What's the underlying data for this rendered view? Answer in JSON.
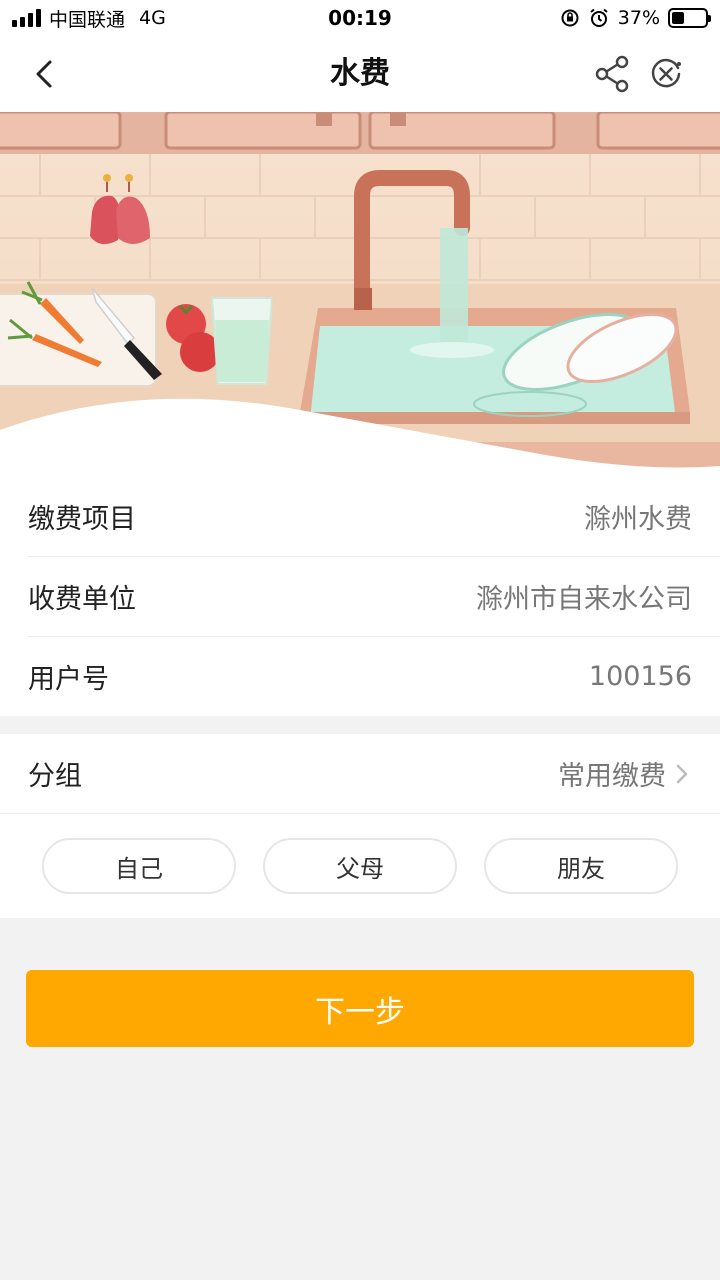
{
  "status_bar": {
    "carrier": "中国联通",
    "network": "4G",
    "time": "00:19",
    "battery_percent": "37%",
    "battery_level": 0.37
  },
  "nav": {
    "title": "水费",
    "back_icon": "chevron-left-icon",
    "share_icon": "share-icon",
    "close_icon": "close-circle-icon"
  },
  "banner": {
    "illustration": "kitchen-sink-water-illustration"
  },
  "info": {
    "rows": [
      {
        "label": "缴费项目",
        "value": "滁州水费"
      },
      {
        "label": "收费单位",
        "value": "滁州市自来水公司"
      },
      {
        "label": "用户号",
        "value": "100156"
      }
    ]
  },
  "group": {
    "label": "分组",
    "value": "常用缴费",
    "chips": [
      "自己",
      "父母",
      "朋友"
    ]
  },
  "actions": {
    "next_label": "下一步"
  },
  "colors": {
    "primary": "#ffa801",
    "page_background": "#f2f2f2"
  }
}
